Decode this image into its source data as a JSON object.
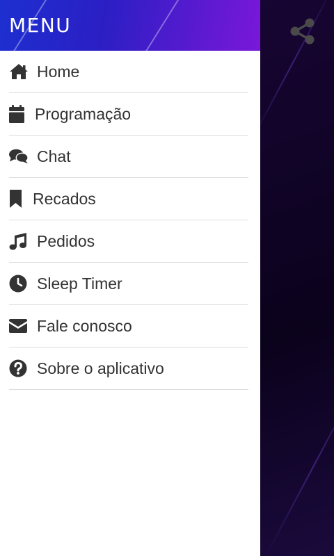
{
  "drawer": {
    "title": "MENU",
    "items": [
      {
        "label": "Home",
        "icon": "home-icon"
      },
      {
        "label": "Programação",
        "icon": "calendar-icon"
      },
      {
        "label": "Chat",
        "icon": "chat-icon"
      },
      {
        "label": "Recados",
        "icon": "bookmark-icon"
      },
      {
        "label": "Pedidos",
        "icon": "music-icon"
      },
      {
        "label": "Sleep Timer",
        "icon": "clock-icon"
      },
      {
        "label": "Fale conosco",
        "icon": "envelope-icon"
      },
      {
        "label": "Sobre o aplicativo",
        "icon": "question-icon"
      }
    ]
  },
  "toolbar": {
    "share_icon": "share-icon"
  },
  "colors": {
    "header_start": "#1d2fd0",
    "header_end": "#7a18d8",
    "icon": "#333333",
    "background": "#12042a"
  }
}
